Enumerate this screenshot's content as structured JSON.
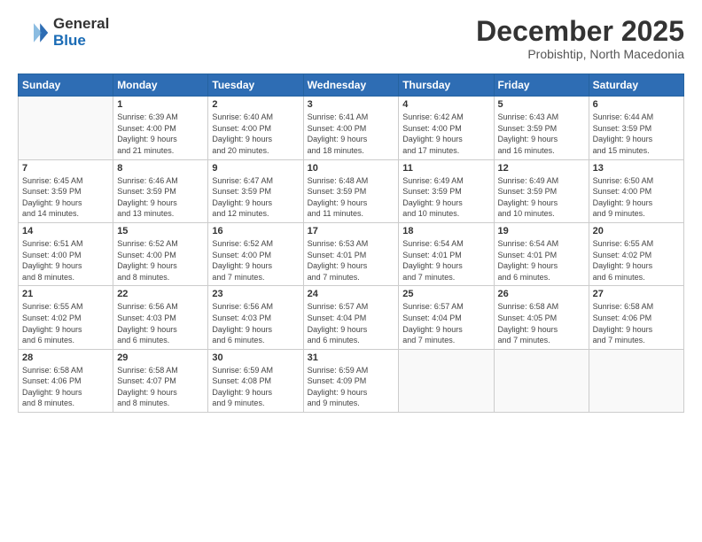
{
  "header": {
    "logo_line1": "General",
    "logo_line2": "Blue",
    "month_title": "December 2025",
    "location": "Probishtip, North Macedonia"
  },
  "weekdays": [
    "Sunday",
    "Monday",
    "Tuesday",
    "Wednesday",
    "Thursday",
    "Friday",
    "Saturday"
  ],
  "weeks": [
    [
      {
        "day": "",
        "info": ""
      },
      {
        "day": "1",
        "info": "Sunrise: 6:39 AM\nSunset: 4:00 PM\nDaylight: 9 hours\nand 21 minutes."
      },
      {
        "day": "2",
        "info": "Sunrise: 6:40 AM\nSunset: 4:00 PM\nDaylight: 9 hours\nand 20 minutes."
      },
      {
        "day": "3",
        "info": "Sunrise: 6:41 AM\nSunset: 4:00 PM\nDaylight: 9 hours\nand 18 minutes."
      },
      {
        "day": "4",
        "info": "Sunrise: 6:42 AM\nSunset: 4:00 PM\nDaylight: 9 hours\nand 17 minutes."
      },
      {
        "day": "5",
        "info": "Sunrise: 6:43 AM\nSunset: 3:59 PM\nDaylight: 9 hours\nand 16 minutes."
      },
      {
        "day": "6",
        "info": "Sunrise: 6:44 AM\nSunset: 3:59 PM\nDaylight: 9 hours\nand 15 minutes."
      }
    ],
    [
      {
        "day": "7",
        "info": "Sunrise: 6:45 AM\nSunset: 3:59 PM\nDaylight: 9 hours\nand 14 minutes."
      },
      {
        "day": "8",
        "info": "Sunrise: 6:46 AM\nSunset: 3:59 PM\nDaylight: 9 hours\nand 13 minutes."
      },
      {
        "day": "9",
        "info": "Sunrise: 6:47 AM\nSunset: 3:59 PM\nDaylight: 9 hours\nand 12 minutes."
      },
      {
        "day": "10",
        "info": "Sunrise: 6:48 AM\nSunset: 3:59 PM\nDaylight: 9 hours\nand 11 minutes."
      },
      {
        "day": "11",
        "info": "Sunrise: 6:49 AM\nSunset: 3:59 PM\nDaylight: 9 hours\nand 10 minutes."
      },
      {
        "day": "12",
        "info": "Sunrise: 6:49 AM\nSunset: 3:59 PM\nDaylight: 9 hours\nand 10 minutes."
      },
      {
        "day": "13",
        "info": "Sunrise: 6:50 AM\nSunset: 4:00 PM\nDaylight: 9 hours\nand 9 minutes."
      }
    ],
    [
      {
        "day": "14",
        "info": "Sunrise: 6:51 AM\nSunset: 4:00 PM\nDaylight: 9 hours\nand 8 minutes."
      },
      {
        "day": "15",
        "info": "Sunrise: 6:52 AM\nSunset: 4:00 PM\nDaylight: 9 hours\nand 8 minutes."
      },
      {
        "day": "16",
        "info": "Sunrise: 6:52 AM\nSunset: 4:00 PM\nDaylight: 9 hours\nand 7 minutes."
      },
      {
        "day": "17",
        "info": "Sunrise: 6:53 AM\nSunset: 4:01 PM\nDaylight: 9 hours\nand 7 minutes."
      },
      {
        "day": "18",
        "info": "Sunrise: 6:54 AM\nSunset: 4:01 PM\nDaylight: 9 hours\nand 7 minutes."
      },
      {
        "day": "19",
        "info": "Sunrise: 6:54 AM\nSunset: 4:01 PM\nDaylight: 9 hours\nand 6 minutes."
      },
      {
        "day": "20",
        "info": "Sunrise: 6:55 AM\nSunset: 4:02 PM\nDaylight: 9 hours\nand 6 minutes."
      }
    ],
    [
      {
        "day": "21",
        "info": "Sunrise: 6:55 AM\nSunset: 4:02 PM\nDaylight: 9 hours\nand 6 minutes."
      },
      {
        "day": "22",
        "info": "Sunrise: 6:56 AM\nSunset: 4:03 PM\nDaylight: 9 hours\nand 6 minutes."
      },
      {
        "day": "23",
        "info": "Sunrise: 6:56 AM\nSunset: 4:03 PM\nDaylight: 9 hours\nand 6 minutes."
      },
      {
        "day": "24",
        "info": "Sunrise: 6:57 AM\nSunset: 4:04 PM\nDaylight: 9 hours\nand 6 minutes."
      },
      {
        "day": "25",
        "info": "Sunrise: 6:57 AM\nSunset: 4:04 PM\nDaylight: 9 hours\nand 7 minutes."
      },
      {
        "day": "26",
        "info": "Sunrise: 6:58 AM\nSunset: 4:05 PM\nDaylight: 9 hours\nand 7 minutes."
      },
      {
        "day": "27",
        "info": "Sunrise: 6:58 AM\nSunset: 4:06 PM\nDaylight: 9 hours\nand 7 minutes."
      }
    ],
    [
      {
        "day": "28",
        "info": "Sunrise: 6:58 AM\nSunset: 4:06 PM\nDaylight: 9 hours\nand 8 minutes."
      },
      {
        "day": "29",
        "info": "Sunrise: 6:58 AM\nSunset: 4:07 PM\nDaylight: 9 hours\nand 8 minutes."
      },
      {
        "day": "30",
        "info": "Sunrise: 6:59 AM\nSunset: 4:08 PM\nDaylight: 9 hours\nand 9 minutes."
      },
      {
        "day": "31",
        "info": "Sunrise: 6:59 AM\nSunset: 4:09 PM\nDaylight: 9 hours\nand 9 minutes."
      },
      {
        "day": "",
        "info": ""
      },
      {
        "day": "",
        "info": ""
      },
      {
        "day": "",
        "info": ""
      }
    ]
  ]
}
